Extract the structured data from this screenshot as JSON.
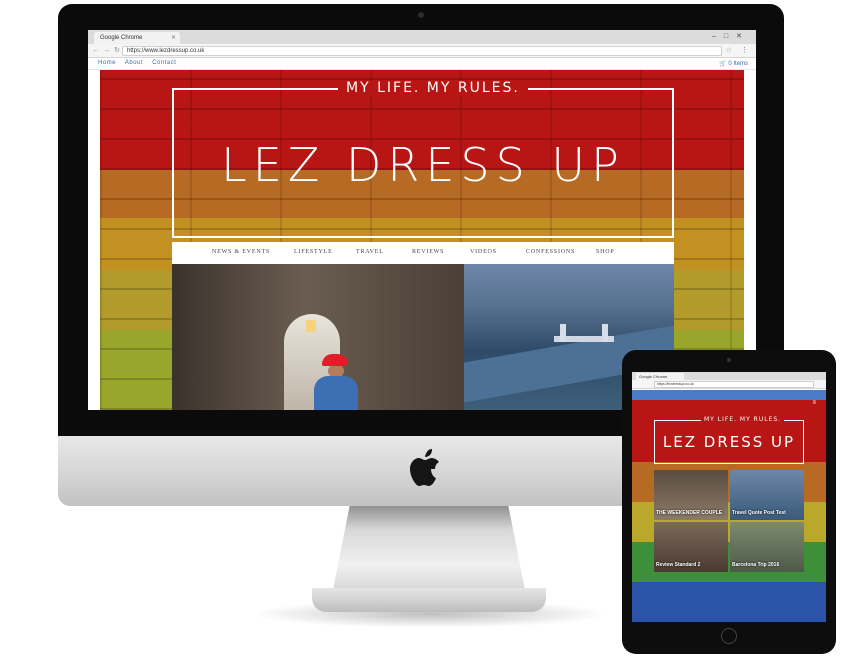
{
  "desktop": {
    "browser": {
      "tab_title": "Google Chrome",
      "url": "https://www.lezdressup.co.uk"
    },
    "site_nav": {
      "links": [
        "Home",
        "About",
        "Contact"
      ],
      "cart": "0 Items"
    },
    "hero": {
      "tagline": "MY LIFE. MY RULES.",
      "title": "LEZ DRESS UP"
    },
    "menu": [
      "NEWS & EVENTS",
      "LIFESTYLE",
      "TRAVEL",
      "REVIEWS",
      "VIDEOS",
      "CONFESSIONS",
      "SHOP"
    ]
  },
  "tablet": {
    "browser": {
      "tab_title": "Google Chrome",
      "url": "https://lezdressup.co.uk"
    },
    "hero": {
      "tagline": "MY LIFE. MY RULES.",
      "title": "LEZ DRESS UP"
    },
    "posts": [
      {
        "caption": "THE WEEKENDER COUPLE"
      },
      {
        "caption": "Travel Quote Post Test"
      },
      {
        "caption": "Barcelona Trip 2016"
      },
      {
        "caption": "Review Standard 2"
      }
    ]
  },
  "colors": {
    "brick_red": "#b71614",
    "brick_orange": "#b76a23",
    "brick_yellow": "#c39022",
    "brick_green": "#9aa52b",
    "link_blue": "#3c6aa8"
  },
  "icons": [
    "apple-logo-icon",
    "cart-icon",
    "star-icon",
    "menu-dots-icon",
    "home-button-icon"
  ]
}
